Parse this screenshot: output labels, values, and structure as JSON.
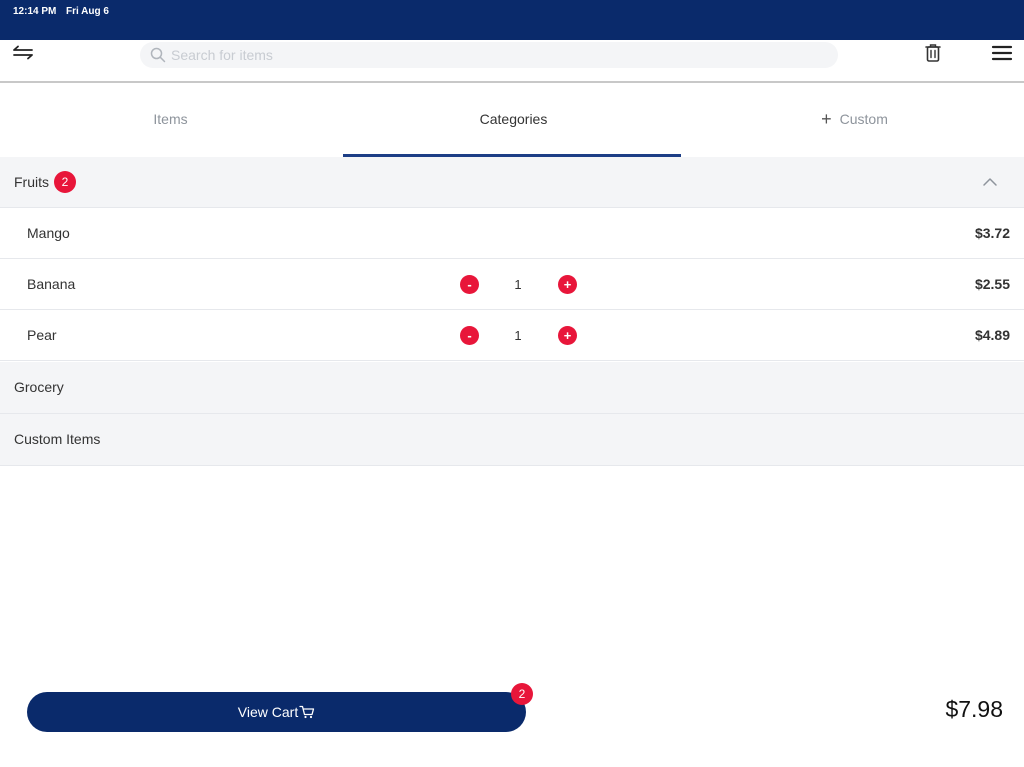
{
  "status_bar": {
    "time": "12:14 PM",
    "date": "Fri Aug 6"
  },
  "toolbar": {
    "left_icon": "swap-arrows-icon",
    "search_placeholder": "Search for items",
    "search_value": "",
    "trash_icon": "trash-icon",
    "menu_icon": "menu-icon"
  },
  "tabs": [
    {
      "label": "Items",
      "active": false
    },
    {
      "label": "Categories",
      "active": true
    },
    {
      "label": "Custom",
      "active": false,
      "icon": "plus-icon"
    }
  ],
  "categories": [
    {
      "name": "Fruits",
      "count": "2",
      "expanded": true,
      "items": [
        {
          "name": "Mango",
          "quantity": null,
          "price": "$3.72"
        },
        {
          "name": "Banana",
          "quantity": "1",
          "price": "$2.55"
        },
        {
          "name": "Pear",
          "quantity": "1",
          "price": "$4.89"
        }
      ]
    },
    {
      "name": "Grocery",
      "expanded": false
    },
    {
      "name": "Custom Items",
      "expanded": false
    }
  ],
  "cart": {
    "button_label": "View Cart",
    "icon": "cart-icon",
    "count": "2",
    "total": "$7.98"
  },
  "controls": {
    "minus": "-",
    "plus": "+"
  },
  "colors": {
    "primary": "#0a2a6b",
    "accent": "#e8163a",
    "tab_indicator": "#1c3e86",
    "category_bg": "#f4f5f7"
  }
}
